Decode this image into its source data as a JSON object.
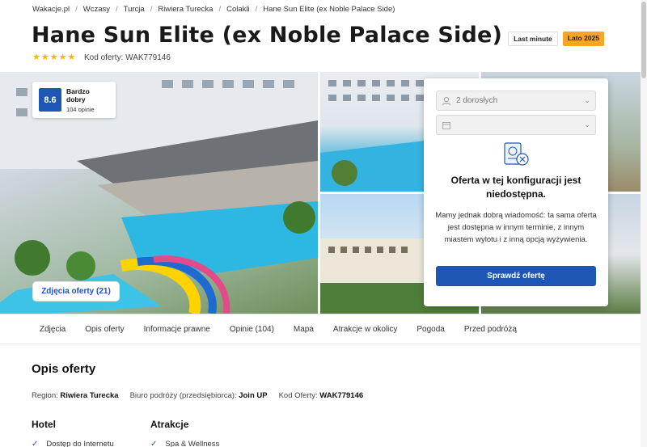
{
  "breadcrumb": [
    "Wakacje.pl",
    "Wczasy",
    "Turcja",
    "Riwiera Turecka",
    "Colakli",
    "Hane Sun Elite (ex Noble Palace Side)"
  ],
  "title": "Hane Sun Elite (ex Noble Palace Side)",
  "badges": {
    "last_minute": "Last minute",
    "season": "Lato 2025"
  },
  "stars": 5,
  "offer_code_line": "Kod oferty: WAK779146",
  "rating": {
    "score": "8.6",
    "label": "Bardzo dobry",
    "count": "104 opinie"
  },
  "photos_button": "Zdjęcia oferty (21)",
  "booking_panel": {
    "travelers": "2 dorosłych",
    "date": "",
    "title": "Oferta w tej konfiguracji jest niedostępna.",
    "text": "Mamy jednak dobrą wiadomość: ta sama oferta jest dostępna w innym terminie, z innym miastem wylotu i z inną opcją wyżywienia.",
    "button": "Sprawdź ofertę"
  },
  "tabs": [
    "Zdjęcia",
    "Opis oferty",
    "Informacje prawne",
    "Opinie (104)",
    "Mapa",
    "Atrakcje w okolicy",
    "Pogoda",
    "Przed podróżą"
  ],
  "section": {
    "title": "Opis oferty",
    "region_label": "Region:",
    "region_value": "Riwiera Turecka",
    "agency_label": "Biuro podróży (przedsiębiorca):",
    "agency_value": "Join UP",
    "code_label": "Kod Oferty:",
    "code_value": "WAK779146"
  },
  "columns": {
    "hotel_title": "Hotel",
    "hotel_item": "Dostęp do Internetu",
    "attractions_title": "Atrakcje",
    "attractions_item": "Spa & Wellness"
  },
  "colors": {
    "accent": "#1e56b6",
    "star": "#f5b800",
    "season_badge": "#f6a623"
  },
  "icons": [
    "star-icon",
    "user-icon",
    "calendar-icon",
    "chevron-down-icon",
    "passport-unavailable-icon",
    "check-icon"
  ]
}
